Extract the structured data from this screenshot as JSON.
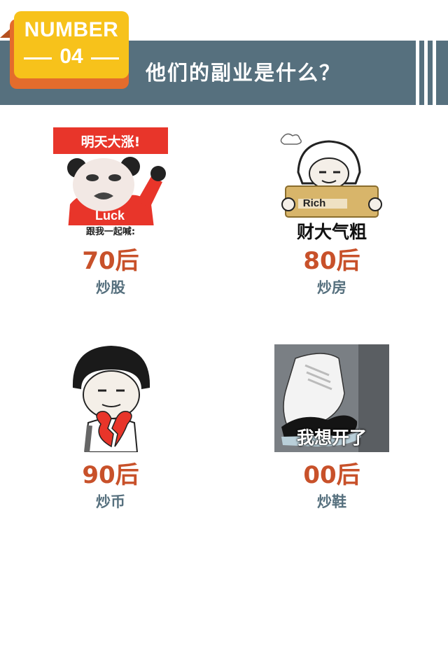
{
  "header": {
    "badge_top": "NUMBER",
    "badge_number": "04",
    "title": "他们的副业是什么？",
    "colors": {
      "banner": "#56707e",
      "badge": "#f7c21b",
      "badge_shadow": "#e46c2c"
    }
  },
  "items": [
    {
      "decade": "70后",
      "activity": "炒股",
      "image": {
        "icon": "panda-meme-luck-icon",
        "top_text": "明天大涨!",
        "shirt_text": "Luck",
        "bottom_text": "跟我一起喊:"
      }
    },
    {
      "decade": "80后",
      "activity": "炒房",
      "image": {
        "icon": "rich-card-meme-icon",
        "card_text": "Rich",
        "bottom_text": "财大气粗"
      }
    },
    {
      "decade": "90后",
      "activity": "炒币",
      "image": {
        "icon": "broken-heart-meme-icon"
      }
    },
    {
      "decade": "00后",
      "activity": "炒鞋",
      "image": {
        "icon": "sneaker-photo-icon",
        "bottom_text": "我想开了"
      }
    }
  ],
  "colors": {
    "decade": "#c8512a",
    "activity": "#56707e"
  }
}
